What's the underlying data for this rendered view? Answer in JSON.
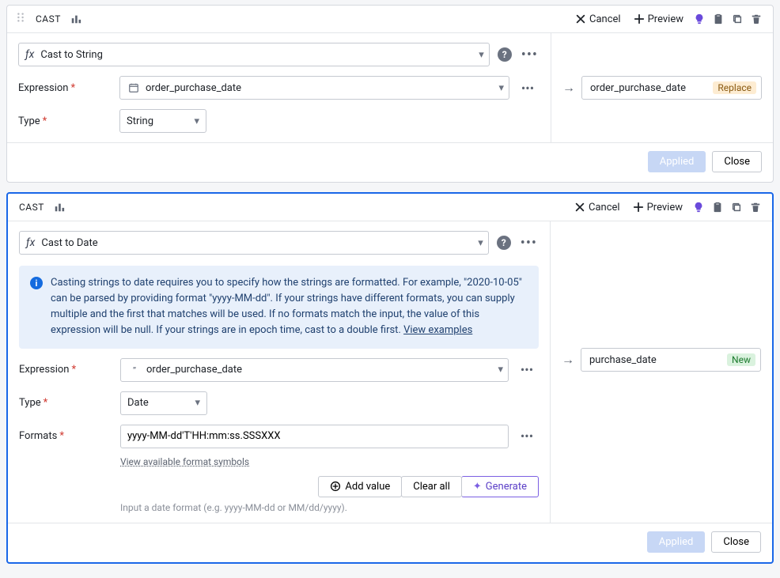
{
  "card1": {
    "title": "CAST",
    "header": {
      "cancel": "Cancel",
      "preview": "Preview"
    },
    "function": {
      "name": "Cast to String"
    },
    "expression": {
      "label": "Expression",
      "value": "order_purchase_date"
    },
    "type": {
      "label": "Type",
      "value": "String"
    },
    "result": {
      "value": "order_purchase_date",
      "badge": "Replace"
    },
    "footer": {
      "applied": "Applied",
      "close": "Close"
    }
  },
  "card2": {
    "title": "CAST",
    "header": {
      "cancel": "Cancel",
      "preview": "Preview"
    },
    "function": {
      "name": "Cast to Date"
    },
    "info": {
      "text": "Casting strings to date requires you to specify how the strings are formatted. For example, \"2020-10-05\" can be parsed by providing format \"yyyy-MM-dd\". If your strings have different formats, you can supply multiple and the first that matches will be used. If no formats match the input, the value of this expression will be null. If your strings are in epoch time, cast to a double first. ",
      "link": "View examples"
    },
    "expression": {
      "label": "Expression",
      "value": "order_purchase_date"
    },
    "type": {
      "label": "Type",
      "value": "Date"
    },
    "formats": {
      "label": "Formats",
      "value": "yyyy-MM-dd'T'HH:mm:ss.SSSXXX",
      "symbols_link": "View available format symbols",
      "add_value": "Add value",
      "clear_all": "Clear all",
      "generate": "Generate",
      "hint": "Input a date format (e.g. yyyy-MM-dd or MM/dd/yyyy)."
    },
    "result": {
      "value": "purchase_date",
      "badge": "New"
    },
    "footer": {
      "applied": "Applied",
      "close": "Close"
    }
  }
}
